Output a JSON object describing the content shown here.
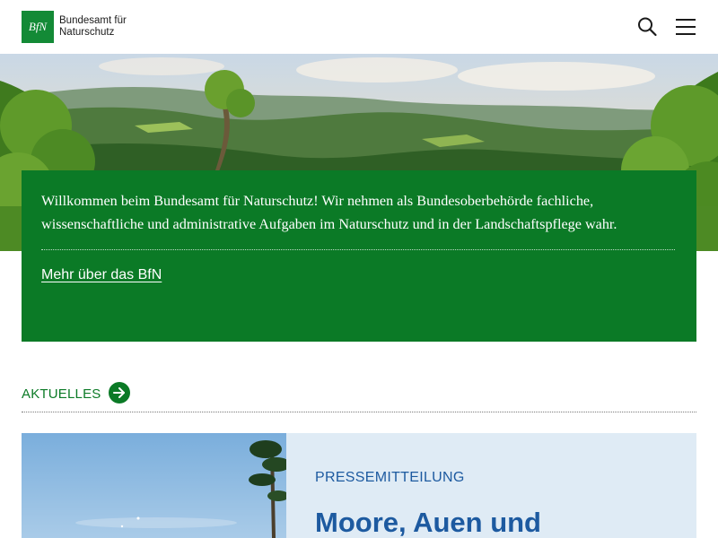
{
  "header": {
    "logo_mark": "BfN",
    "logo_line1": "Bundesamt für",
    "logo_line2": "Naturschutz"
  },
  "icons": {
    "search": "search-icon",
    "menu": "hamburger-menu-icon",
    "arrow": "arrow-right-icon"
  },
  "intro": {
    "text": "Willkommen beim Bundesamt für Naturschutz! Wir nehmen als Bundesoberbehörde fachliche, wissenschaftliche und administrative Aufgaben im Naturschutz und in der Landschaftspflege wahr.",
    "link": "Mehr über das BfN"
  },
  "section": {
    "title": "AKTUELLES"
  },
  "card": {
    "kicker": "PRESSEMITTEILUNG",
    "title": "Moore, Auen und"
  },
  "colors": {
    "brand_green": "#0b7a26",
    "logo_green": "#138a36",
    "card_bg": "#dfebf5",
    "card_text": "#1d5aa0"
  }
}
